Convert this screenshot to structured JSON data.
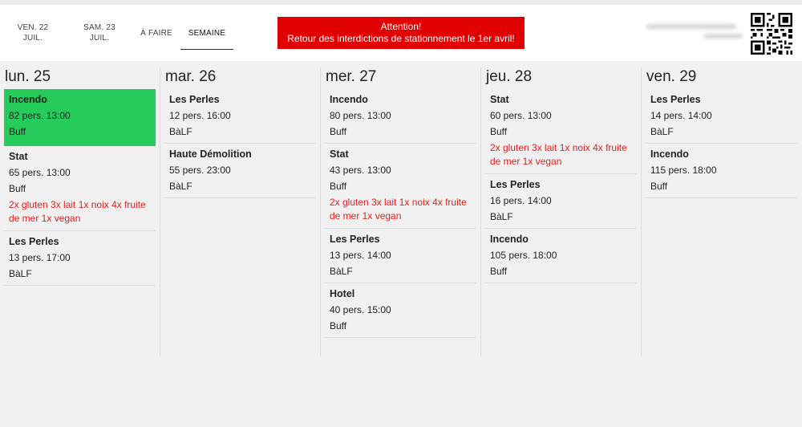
{
  "tabs": [
    {
      "line1": "VEN. 22",
      "line2": "JUIL."
    },
    {
      "line1": "SAM. 23",
      "line2": "JUIL."
    },
    {
      "line1": "À FAIRE",
      "line2": ""
    },
    {
      "line1": "SEMAINE",
      "line2": ""
    }
  ],
  "alert": {
    "title": "Attention!",
    "message": "Retour des interdictions de stationnement le 1er avril!"
  },
  "colors": {
    "alert_bg": "#e10000",
    "highlight": "#26cc5a",
    "note": "#e02020"
  },
  "days": [
    {
      "label": "lun. 25",
      "events": [
        {
          "name": "Incendo",
          "info": "82 pers. 13:00",
          "service": "Buff",
          "highlight": true
        },
        {
          "name": "Stat",
          "info": "65 pers. 13:00",
          "service": "Buff",
          "note": "2x gluten 3x lait 1x noix 4x fruite de mer 1x vegan"
        },
        {
          "name": "Les Perles",
          "info": "13 pers. 17:00",
          "service": "BàLF"
        }
      ]
    },
    {
      "label": "mar. 26",
      "events": [
        {
          "name": "Les Perles",
          "info": "12 pers. 16:00",
          "service": "BàLF"
        },
        {
          "name": "Haute Démolition",
          "info": "55 pers. 23:00",
          "service": "BàLF"
        }
      ]
    },
    {
      "label": "mer. 27",
      "events": [
        {
          "name": "Incendo",
          "info": "80 pers. 13:00",
          "service": "Buff"
        },
        {
          "name": "Stat",
          "info": "43 pers. 13:00",
          "service": "Buff",
          "note": "2x gluten 3x lait 1x noix 4x fruite de mer 1x vegan"
        },
        {
          "name": "Les Perles",
          "info": "13 pers. 14:00",
          "service": "BàLF"
        },
        {
          "name": "Hotel",
          "info": "40 pers. 15:00",
          "service": "Buff"
        }
      ]
    },
    {
      "label": "jeu. 28",
      "events": [
        {
          "name": "Stat",
          "info": "60 pers. 13:00",
          "service": "Buff",
          "note": "2x gluten 3x lait 1x noix 4x fruite de mer 1x vegan"
        },
        {
          "name": "Les Perles",
          "info": "16 pers. 14:00",
          "service": "BàLF"
        },
        {
          "name": "Incendo",
          "info": "105 pers. 18:00",
          "service": "Buff"
        }
      ]
    },
    {
      "label": "ven. 29",
      "events": [
        {
          "name": "Les Perles",
          "info": "14 pers. 14:00",
          "service": "BàLF"
        },
        {
          "name": "Incendo",
          "info": "115 pers. 18:00",
          "service": "Buff"
        }
      ]
    }
  ]
}
